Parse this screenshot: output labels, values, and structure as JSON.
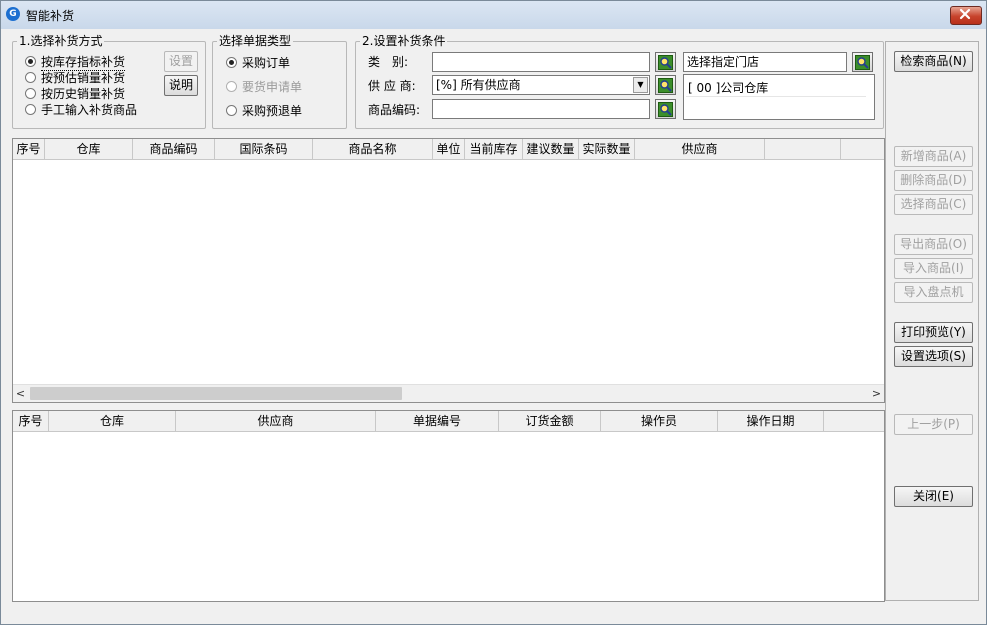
{
  "window": {
    "title": "智能补货",
    "app_icon": "app-icon",
    "close_glyph": "x"
  },
  "group1": {
    "legend": "1.选择补货方式",
    "options": [
      "按库存指标补货",
      "按预估销量补货",
      "按历史销量补货",
      "手工输入补货商品"
    ],
    "selected_index": 0,
    "settings_button": "设置",
    "help_button": "说明"
  },
  "group2": {
    "legend": "选择单据类型",
    "options": [
      "采购订单",
      "要货申请单",
      "采购预退单"
    ],
    "selected_index": 0,
    "disabled_index": 1
  },
  "group3": {
    "legend": "2.设置补货条件",
    "category_label": "类　别:",
    "category_value": "",
    "supplier_label": "供 应 商:",
    "supplier_value": "[%] 所有供应商",
    "code_label": "商品编码:",
    "code_value": "",
    "store_value": "选择指定门店",
    "store_list": [
      "[ 00 ]公司仓库"
    ]
  },
  "upper_table": {
    "columns": [
      "序号",
      "仓库",
      "商品编码",
      "国际条码",
      "商品名称",
      "单位",
      "当前库存",
      "建议数量",
      "实际数量",
      "供应商",
      ""
    ],
    "rows": []
  },
  "lower_table": {
    "columns": [
      "序号",
      "仓库",
      "供应商",
      "单据编号",
      "订货金额",
      "操作员",
      "操作日期",
      ""
    ],
    "rows": []
  },
  "buttons": {
    "search": "检索商品(N)",
    "add": "新增商品(A)",
    "delete": "删除商品(D)",
    "select": "选择商品(C)",
    "export": "导出商品(O)",
    "import": "导入商品(I)",
    "import_counter": "导入盘点机",
    "print_preview": "打印预览(Y)",
    "options": "设置选项(S)",
    "prev": "上一步(P)",
    "close": "关闭(E)"
  },
  "scroll": {
    "left": "<",
    "right": ">"
  },
  "colors": {
    "title_bar": "#c9d8ea",
    "close_button": "#c7432c",
    "window_bg": "#f0f0f0"
  }
}
